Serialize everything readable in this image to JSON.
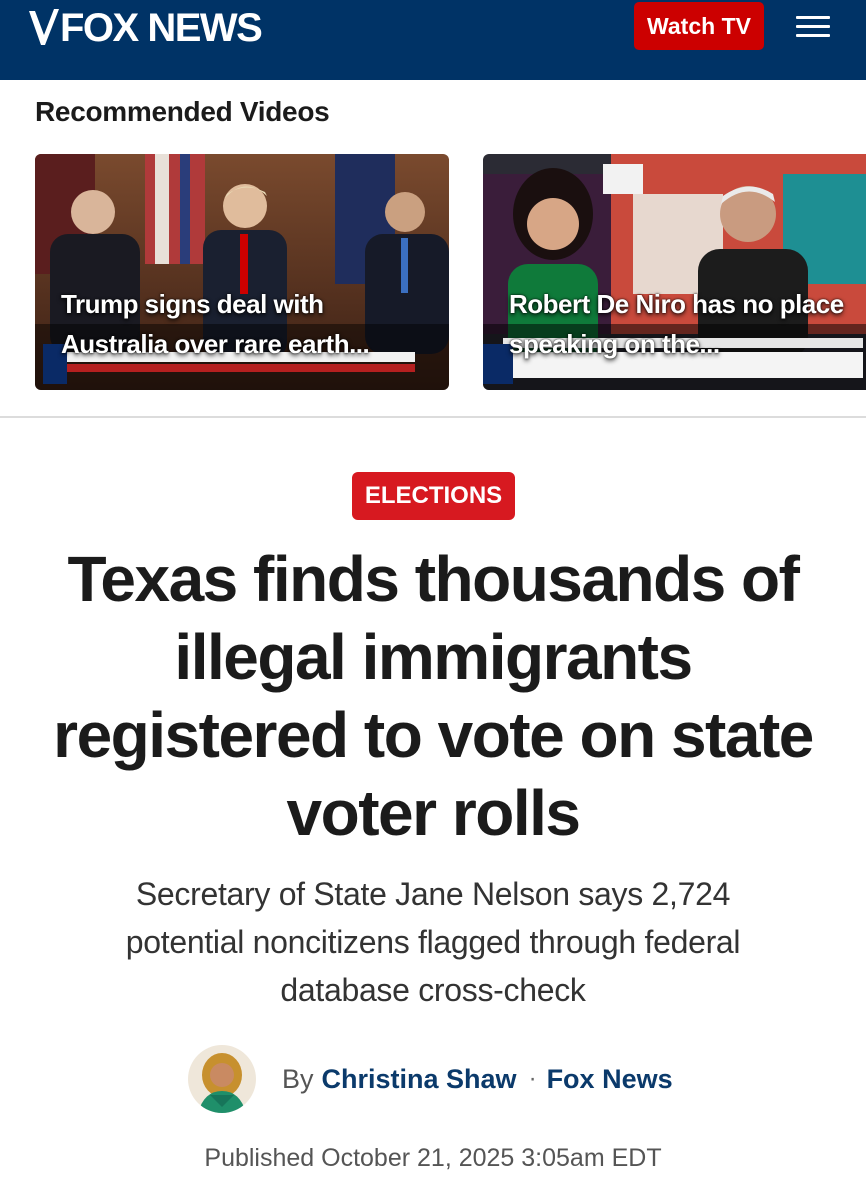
{
  "header": {
    "brand": "FOX NEWS",
    "watch_label": "Watch TV",
    "brand_color": "#003366",
    "accent_color": "#cc0000"
  },
  "recommended": {
    "title": "Recommended Videos",
    "videos": [
      {
        "title": "Trump signs deal with Australia over rare earth...",
        "thumbnail_icon": "press-conference-thumbnail"
      },
      {
        "title": "Robert De Niro has no place speaking on the...",
        "thumbnail_icon": "interview-split-screen-thumbnail"
      }
    ]
  },
  "article": {
    "tag": "ELECTIONS",
    "headline": "Texas finds thousands of illegal immigrants registered to vote on state voter rolls",
    "subhead": "Secretary of State Jane Nelson says 2,724 potential noncitizens flagged through federal database cross-check",
    "byline": {
      "by": "By",
      "author": "Christina Shaw",
      "separator": "·",
      "outlet": "Fox News"
    },
    "published": "Published October 21, 2025 3:05am EDT"
  }
}
